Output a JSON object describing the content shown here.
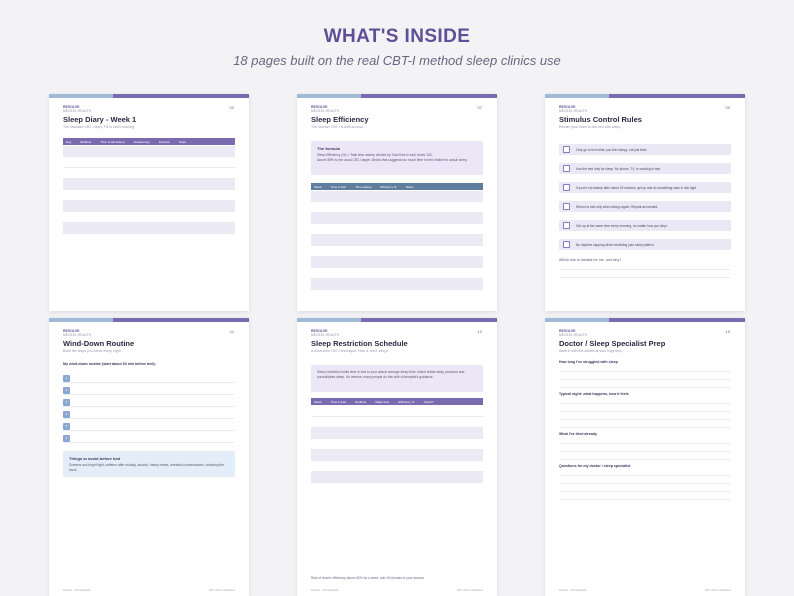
{
  "hero": {
    "title": "WHAT'S INSIDE",
    "subtitle": "18 pages built on the real CBT-I method sleep clinics use"
  },
  "colors": {
    "accent": "#5e4f97",
    "band_light": "#9fb9d6",
    "band_dark": "#7a6bb0",
    "lavender_fill": "#ece7f6",
    "blue_fill": "#e4eef9"
  },
  "brand": {
    "name": "RESOLVE",
    "tagline": "MENTAL HEALTH"
  },
  "pages": {
    "p1": {
      "number": "03",
      "title": "Sleep Diary - Week 1",
      "subtitle": "The standard CBT-I diary. Fill in each morning.",
      "headers": [
        "Day",
        "Bedtime",
        "Time to fall asleep",
        "Awakenings",
        "Duration",
        "Naps"
      ]
    },
    "p2": {
      "number": "07",
      "title": "Sleep Efficiency",
      "subtitle": "The number CBT-I is built around.",
      "callout_title": "The formula",
      "callout_formula": "Sleep Efficiency (%) = Total time asleep divided by Total time in bed, times 100.",
      "callout_note": "Above 85% is the usual CBT-I target. Below that suggests too much time in bed relative to actual sleep.",
      "headers": [
        "Week",
        "Time in bed",
        "Time asleep",
        "Efficiency %",
        "Notes"
      ]
    },
    "p3": {
      "number": "09",
      "title": "Stimulus Control Rules",
      "subtitle": "Retrain your brain to link bed with sleep.",
      "rules": [
        "Only go to bed when you feel sleepy, not just tired.",
        "Use the bed only for sleep. No phone, TV, or working in bed.",
        "If you're not asleep after about 20 minutes, get up and do something calm in dim light.",
        "Return to bed only when sleepy again. Repeat as needed.",
        "Get up at the same time every morning, no matter how you slept.",
        "No daytime napping while rebuilding your sleep pattern."
      ],
      "question": "Which rule is hardest for me, and why?"
    },
    "p4": {
      "number": "11",
      "title": "Wind-Down Routine",
      "subtitle": "Build the steps you follow every night.",
      "prompt": "My wind-down routine (start about 60 min before bed):",
      "steps": [
        "1",
        "2",
        "3",
        "4",
        "5",
        "6"
      ],
      "callout_title": "Things to avoid before bed",
      "callout_body": "Screens and bright light, caffeine after midday, alcohol, heavy meals, stressful conversations, checking the clock."
    },
    "p5": {
      "number": "13",
      "title": "Sleep Restriction Schedule",
      "subtitle": "A short-term CBT-I technique. Plan it, don't wing it.",
      "callout_body": "Sleep restriction limits time in bed to your actual average sleep time, which builds sleep pressure and consolidates sleep. It's intense; many people do this with a therapist's guidance.",
      "headers": [
        "Week",
        "Time in bed",
        "Bedtime",
        "Wake time",
        "Efficiency %",
        "Adjust?"
      ],
      "note": "Rule of thumb: efficiency above 85% for a week, add 15 minutes to your window."
    },
    "p6": {
      "number": "15",
      "title": "Doctor / Sleep Specialist Prep",
      "subtitle": "Walk in with the details at your fingertips.",
      "questions": [
        "How long I've struggled with sleep",
        "Typical night: what happens, how it feels",
        "What I've tried already",
        "Questions for my doctor / sleep specialist"
      ]
    }
  },
  "footer": {
    "left": "Resolve · Mental Health",
    "right": "CBT-I Sleep Workbook"
  }
}
